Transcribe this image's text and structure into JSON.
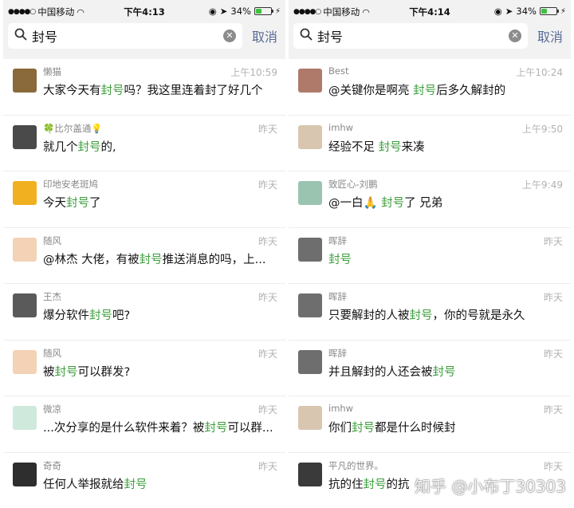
{
  "keyword": "封号",
  "panels": [
    {
      "status": {
        "carrier": "中国移动",
        "time": "下午4:13",
        "battery": "34%"
      },
      "search": {
        "query": "封号",
        "cancel": "取消"
      },
      "results": [
        {
          "name": "懒猫",
          "time": "上午10:59",
          "avatar": "cat-avatar",
          "avatar_color": "#8a6a3a",
          "msg": [
            "大家今天有",
            "封号",
            "吗？我这里连着封了好几个"
          ]
        },
        {
          "name": "🍀比尔盖通💡",
          "time": "昨天",
          "avatar": "photo-avatar",
          "avatar_color": "#4a4a4a",
          "msg": [
            "就几个",
            "封号",
            "的,"
          ]
        },
        {
          "name": "印地安老斑鸠",
          "time": "昨天",
          "avatar": "bird-avatar",
          "avatar_color": "#f0b020",
          "msg": [
            "今天",
            "封号",
            "了"
          ]
        },
        {
          "name": "随风",
          "time": "昨天",
          "avatar": "logo-avatar",
          "avatar_color": "#f3d2b6",
          "msg": [
            "@林杰 大佬，有被",
            "封号",
            "推送消息的吗，上..."
          ]
        },
        {
          "name": "王杰",
          "time": "昨天",
          "avatar": "landscape-avatar",
          "avatar_color": "#5a5a5a",
          "msg": [
            "爆分软件",
            "封号",
            "吧?"
          ]
        },
        {
          "name": "随风",
          "time": "昨天",
          "avatar": "logo-avatar",
          "avatar_color": "#f3d2b6",
          "msg": [
            "被",
            "封号",
            "可以群发?"
          ]
        },
        {
          "name": "微凉",
          "time": "昨天",
          "avatar": "text-avatar",
          "avatar_color": "#cfe9dc",
          "msg": [
            "...次分享的是什么软件来着？被",
            "封号",
            "可以群..."
          ]
        },
        {
          "name": "奇奇",
          "time": "昨天",
          "avatar": "girl-avatar",
          "avatar_color": "#2e2e2e",
          "msg": [
            "任何人举报就给",
            "封号",
            ""
          ]
        }
      ]
    },
    {
      "status": {
        "carrier": "中国移动",
        "time": "下午4:14",
        "battery": "34%"
      },
      "search": {
        "query": "封号",
        "cancel": "取消"
      },
      "results": [
        {
          "name": "Best",
          "time": "上午10:24",
          "avatar": "face-avatar",
          "avatar_color": "#b07a6a",
          "msg": [
            "@关键你是啊亮 ",
            "封号",
            "后多久解封的"
          ]
        },
        {
          "name": "imhw",
          "time": "上午9:50",
          "avatar": "baby-avatar",
          "avatar_color": "#d9c6b0",
          "msg": [
            "经验不足 ",
            "封号",
            "来凑"
          ]
        },
        {
          "name": "致匠心-刘鹏",
          "time": "上午9:49",
          "avatar": "person-avatar",
          "avatar_color": "#9bc4b0",
          "msg": [
            "@一白🙏 ",
            "封号",
            "了 兄弟"
          ]
        },
        {
          "name": "晖辞",
          "time": "昨天",
          "avatar": "bw-avatar",
          "avatar_color": "#6e6e6e",
          "msg": [
            "",
            "封号",
            ""
          ]
        },
        {
          "name": "晖辞",
          "time": "昨天",
          "avatar": "bw-avatar",
          "avatar_color": "#6e6e6e",
          "msg": [
            "只要解封的人被",
            "封号",
            "，你的号就是永久"
          ]
        },
        {
          "name": "晖辞",
          "time": "昨天",
          "avatar": "bw-avatar",
          "avatar_color": "#6e6e6e",
          "msg": [
            "并且解封的人还会被",
            "封号",
            ""
          ]
        },
        {
          "name": "imhw",
          "time": "昨天",
          "avatar": "baby-avatar",
          "avatar_color": "#d9c6b0",
          "msg": [
            "你们",
            "封号",
            "都是什么时候封"
          ]
        },
        {
          "name": "平凡的世界。",
          "time": "昨天",
          "avatar": "man-avatar",
          "avatar_color": "#3a3a3a",
          "msg": [
            "抗的住",
            "封号",
            "的抗"
          ]
        }
      ]
    }
  ],
  "watermark": "知乎 @小布丁30303",
  "colors": {
    "keyword": "#3c9e3c",
    "cancel": "#576b95",
    "topbar": "#f2f2f2"
  }
}
